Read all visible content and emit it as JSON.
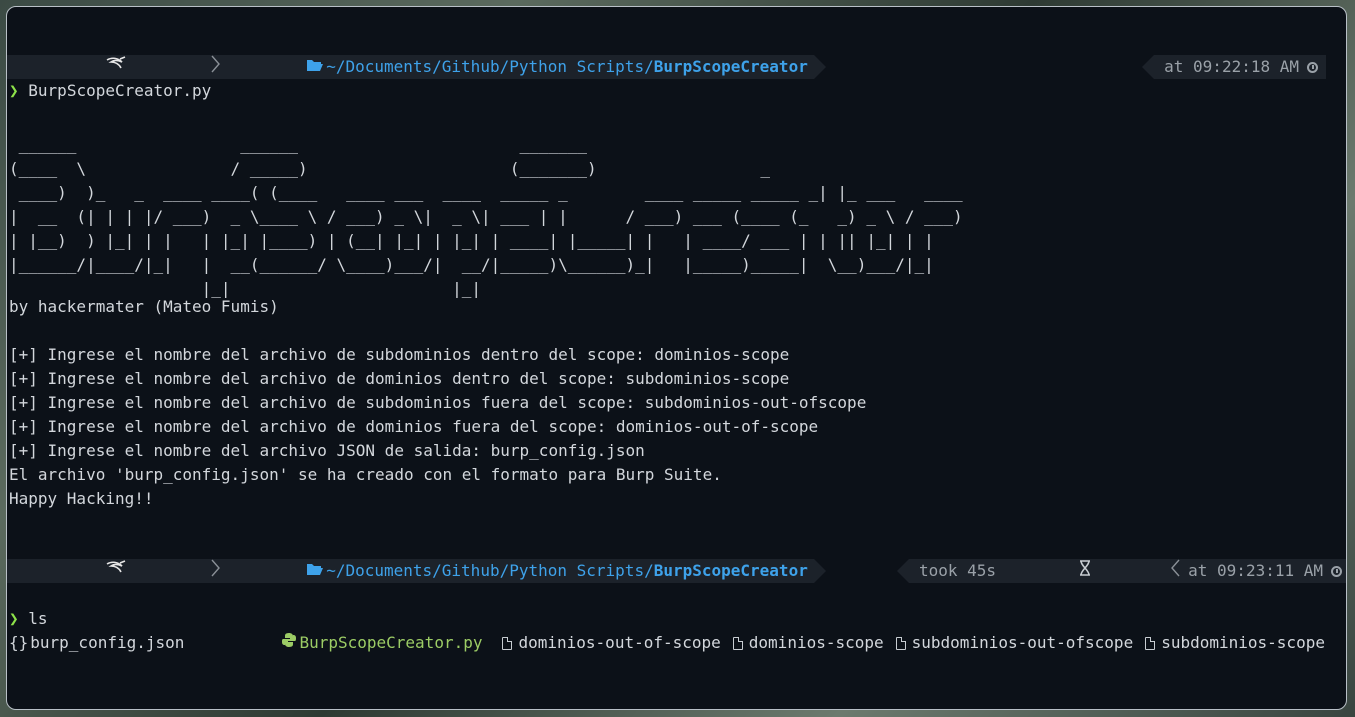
{
  "prompt1": {
    "kali_glyph": "☠",
    "separator": "❯",
    "path_prefix": "~/Documents/Github/Python Scripts/",
    "path_current": "BurpScopeCreator",
    "time_label": "at 09:22:18 AM"
  },
  "command1": {
    "chevron": "❯",
    "text": "BurpScopeCreator.py"
  },
  "banner": [
    " ______                 ______                       _______",
    "(____  \\               / _____)                     (_______)                 _",
    " ____)  )_   _  ____ ____( (____   ____ ___  ____  _____ _        ____ _____ _____ _| |_ ___   ____",
    "|  __  (| | | |/ ___)  _ \\____ \\ / ___) _ \\|  _ \\| ___ | |      / ___) ___ (____ (_   _) _ \\ / ___)",
    "| |__)  ) |_| | |   | |_| |____) | (__| |_| | |_| | ____| |_____| |   | ____/ ___ | | || |_| | |",
    "|______/|____/|_|   |  __(______/ \\____)___/|  __/|_____)\\______)_|   |_____)_____|  \\__)___/|_|",
    "                    |_|                       |_|"
  ],
  "author_line": "by hackermater (Mateo Fumis)",
  "output_lines": [
    "[+] Ingrese el nombre del archivo de subdominios dentro del scope: dominios-scope",
    "[+] Ingrese el nombre del archivo de dominios dentro del scope: subdominios-scope",
    "[+] Ingrese el nombre del archivo de subdominios fuera del scope: subdominios-out-ofscope",
    "[+] Ingrese el nombre del archivo de dominios fuera del scope: dominios-out-of-scope",
    "[+] Ingrese el nombre del archivo JSON de salida: burp_config.json",
    "El archivo 'burp_config.json' se ha creado con el formato para Burp Suite.",
    "Happy Hacking!!"
  ],
  "prompt2": {
    "path_prefix": "~/Documents/Github/Python Scripts/",
    "path_current": "BurpScopeCreator",
    "took_label": "took 45s",
    "time_label": "at 09:23:11 AM"
  },
  "command2": {
    "chevron": "❯",
    "text": "ls"
  },
  "ls_items": [
    {
      "icon": "json-icon",
      "glyph": "{}",
      "name": "burp_config.json"
    },
    {
      "icon": "python-icon",
      "glyph": "⚕",
      "name": "BurpScopeCreator.py"
    },
    {
      "icon": "file-icon",
      "name": "dominios-out-of-scope"
    },
    {
      "icon": "file-icon",
      "name": "dominios-scope"
    },
    {
      "icon": "file-icon",
      "name": "subdominios-out-ofscope"
    },
    {
      "icon": "file-icon",
      "name": "subdominios-scope"
    }
  ]
}
